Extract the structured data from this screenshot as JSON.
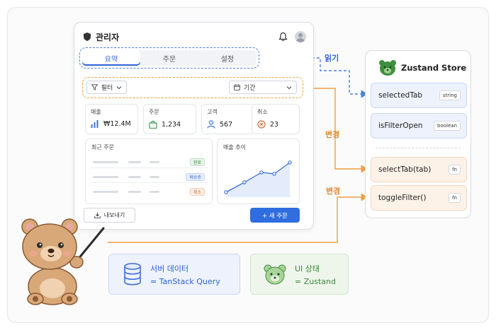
{
  "admin": {
    "title": "관리자",
    "tabs": [
      {
        "label": "요약",
        "active": true
      },
      {
        "label": "주문",
        "active": false
      },
      {
        "label": "설정",
        "active": false
      }
    ],
    "filter_label": "필터",
    "period_label": "기간",
    "stats": [
      {
        "label": "매출",
        "value": "₩12.4M",
        "icon": "bar-chart-icon"
      },
      {
        "label": "주문",
        "value": "1,234",
        "icon": "shopping-bag-icon"
      },
      {
        "label": "고객",
        "value": "567",
        "icon": "user-icon"
      },
      {
        "label": "취소",
        "value": "23",
        "icon": "cancel-circle-icon"
      }
    ],
    "recent_orders": {
      "title": "최근 주문",
      "rows": [
        {
          "status": "완료"
        },
        {
          "status": "배송중"
        },
        {
          "status": "취소"
        }
      ]
    },
    "sales_trend": {
      "title": "매출 추이"
    },
    "export_label": "내보내기",
    "new_order_label": "+  새 주문"
  },
  "store": {
    "title": "Zustand Store",
    "items": [
      {
        "name": "selectedTab",
        "type": "string"
      },
      {
        "name": "isFilterOpen",
        "type": "boolean"
      },
      {
        "name": "selectTab(tab)",
        "type": "fn"
      },
      {
        "name": "toggleFilter()",
        "type": "fn"
      }
    ]
  },
  "arrows": {
    "read": "읽기",
    "change1": "변경",
    "change2": "변경"
  },
  "legend": {
    "server": {
      "line1": "서버 데이터",
      "line2": "= TanStack Query"
    },
    "ui": {
      "line1": "UI 상태",
      "line2": "= Zustand"
    }
  },
  "colors": {
    "read_arrow": "#4a7fe0",
    "change_arrow": "#f0a040",
    "primary": "#2f6de0"
  }
}
